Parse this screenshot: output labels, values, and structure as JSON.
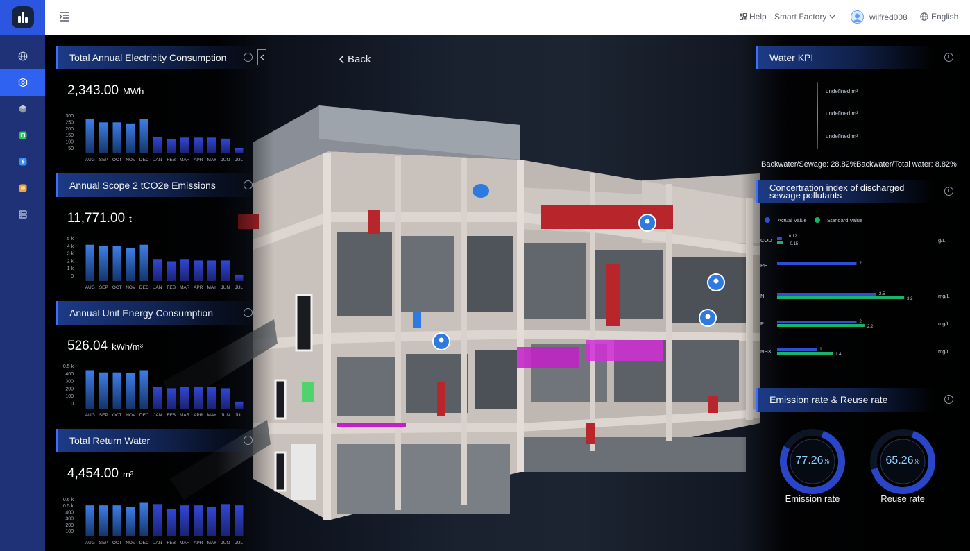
{
  "header": {
    "help": "Help",
    "project": "Smart Factory",
    "user": "wilfred008",
    "language": "English"
  },
  "sidebar": {
    "items": [
      {
        "icon": "globe-icon"
      },
      {
        "icon": "hexagon-icon",
        "active": true
      },
      {
        "icon": "cube-icon"
      },
      {
        "icon": "chip-icon"
      },
      {
        "icon": "lightning-icon"
      },
      {
        "icon": "note-icon"
      },
      {
        "icon": "server-icon"
      }
    ]
  },
  "back_label": "Back",
  "left_panels": [
    {
      "title": "Total Annual Electricity Consumption",
      "value": "2,343.00",
      "unit": "MWh",
      "chart_data": {
        "type": "bar",
        "categories": [
          "AUG",
          "SEP",
          "OCT",
          "NOV",
          "DEC",
          "JAN",
          "FEB",
          "MAR",
          "APR",
          "MAY",
          "JUN",
          "JUL"
        ],
        "values": [
          268,
          245,
          245,
          237,
          268,
          134,
          116,
          128,
          128,
          128,
          120,
          20
        ],
        "yticks": [
          "300",
          "250",
          "200",
          "150",
          "100",
          "50"
        ],
        "ylim": [
          50,
          300
        ]
      }
    },
    {
      "title": "Annual Scope 2 tCO2e Emissions",
      "value": "11,771.00",
      "unit": "t",
      "chart_data": {
        "type": "bar",
        "categories": [
          "AUG",
          "SEP",
          "OCT",
          "NOV",
          "DEC",
          "JAN",
          "FEB",
          "MAR",
          "APR",
          "MAY",
          "JUN",
          "JUL"
        ],
        "values": [
          4100,
          3900,
          3900,
          3700,
          4100,
          2200,
          1900,
          2200,
          2000,
          2000,
          2000,
          100
        ],
        "yticks": [
          "5 k",
          "4 k",
          "3 k",
          "2 k",
          "1 k",
          "0"
        ],
        "ylim": [
          0,
          5000
        ]
      }
    },
    {
      "title": "Annual Unit Energy Consumption",
      "value": "526.04",
      "unit": "kWh/m³",
      "chart_data": {
        "type": "bar",
        "categories": [
          "AUG",
          "SEP",
          "OCT",
          "NOV",
          "DEC",
          "JAN",
          "FEB",
          "MAR",
          "APR",
          "MAY",
          "JUN",
          "JUL"
        ],
        "values": [
          440,
          410,
          410,
          400,
          440,
          220,
          200,
          220,
          220,
          220,
          200,
          20
        ],
        "yticks": [
          "0.5 k",
          "400",
          "300",
          "200",
          "100",
          "0"
        ],
        "ylim": [
          0,
          500
        ]
      }
    },
    {
      "title": "Total Return Water",
      "value": "4,454.00",
      "unit": "m³",
      "chart_data": {
        "type": "bar",
        "categories": [
          "AUG",
          "SEP",
          "OCT",
          "NOV",
          "DEC",
          "JAN",
          "FEB",
          "MAR",
          "APR",
          "MAY",
          "JUN",
          "JUL"
        ],
        "values": [
          500,
          500,
          500,
          470,
          540,
          520,
          440,
          500,
          500,
          470,
          520,
          500
        ],
        "yticks": [
          "0.6 k",
          "0.5 k",
          "400",
          "300",
          "200",
          "100"
        ],
        "ylim": [
          100,
          600
        ]
      }
    }
  ],
  "water_kpi": {
    "title": "Water KPI",
    "items": [
      "undefined m³",
      "undefined m³",
      "undefined m³"
    ],
    "backwater_sewage": "Backwater/Sewage: 28.82%",
    "backwater_total": "Backwater/Total water: 8.82%"
  },
  "pollutants": {
    "title": "Concertration index of discharged sewage pollutants",
    "legend_actual": "Actual Value",
    "legend_standard": "Standard Value",
    "actual_color": "#2d4fd6",
    "standard_color": "#19b36b",
    "chart_data": {
      "type": "bar",
      "categories": [
        "COD",
        "PH",
        "N",
        "P",
        "NH3"
      ],
      "series": [
        {
          "name": "Actual Value",
          "values": [
            0.12,
            2,
            2.5,
            2,
            1
          ]
        },
        {
          "name": "Standard Value",
          "values": [
            0.15,
            null,
            3.2,
            2.2,
            1.4
          ]
        }
      ],
      "labels": {
        "actual": [
          "0.12",
          "2",
          "2.5",
          "2",
          "1"
        ],
        "standard": [
          "0.15",
          "",
          "3.2",
          "2.2",
          "1.4"
        ]
      },
      "units": [
        "g/L",
        "",
        "mg/L",
        "mg/L",
        "mg/L"
      ],
      "xlim": [
        0,
        3.6
      ]
    }
  },
  "rates": {
    "title": "Emission rate & Reuse rate",
    "emission_value": "77.26",
    "emission_fraction": 0.7726,
    "emission_label": "Emission rate",
    "reuse_value": "65.26",
    "reuse_fraction": 0.6526,
    "reuse_label": "Reuse rate",
    "percent": "%"
  }
}
